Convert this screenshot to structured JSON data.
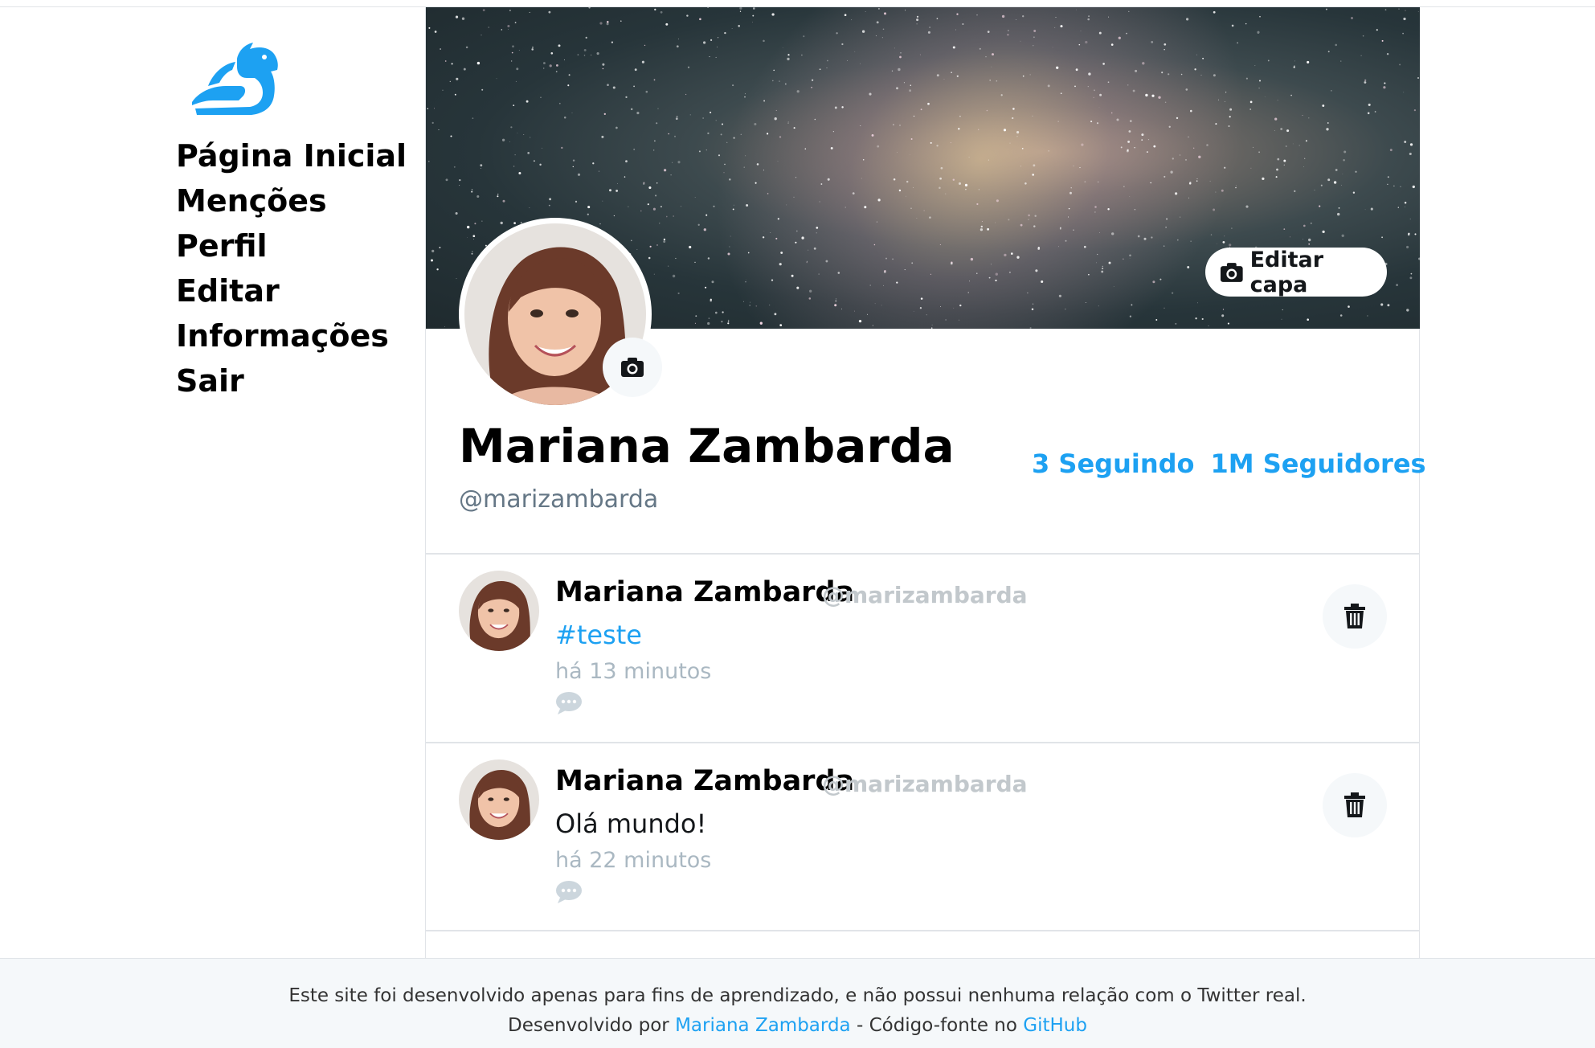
{
  "nav": {
    "items": [
      "Página Inicial",
      "Menções",
      "Perfil",
      "Editar",
      "Informações",
      "Sair"
    ]
  },
  "profile": {
    "edit_cover_label": "Editar capa",
    "name": "Mariana Zambarda",
    "handle": "@marizambarda",
    "following": "3 Seguindo",
    "followers": "1M Seguidores"
  },
  "tweets": [
    {
      "name": "Mariana Zambarda",
      "handle": "@marizambarda",
      "text": "#teste",
      "time": "há 13 minutos"
    },
    {
      "name": "Mariana Zambarda",
      "handle": "@marizambarda",
      "text": "Olá mundo!",
      "time": "há 22 minutos"
    }
  ],
  "footer": {
    "line1": "Este site foi desenvolvido apenas para fins de aprendizado, e não possui nenhuma relação com o Twitter real.",
    "line2_prefix": "Desenvolvido por",
    "author": "Mariana Zambarda",
    "line2_middle": "- Código-fonte no",
    "source_link": "GitHub"
  },
  "colors": {
    "accent": "#1da1f2",
    "muted": "#657786",
    "border": "#e1e4e8"
  },
  "icons": [
    "dragon-logo-icon",
    "camera-icon",
    "trash-icon",
    "comment-icon"
  ]
}
